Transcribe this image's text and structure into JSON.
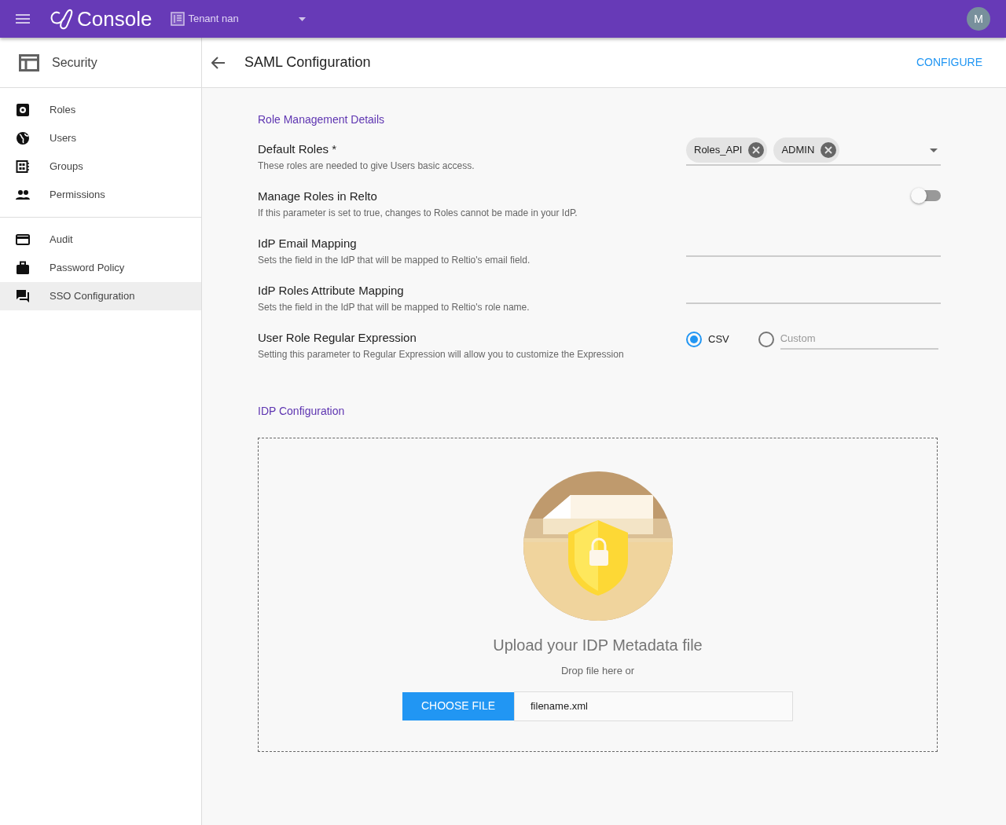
{
  "header": {
    "app_name": "Console",
    "tenant": "Tenant nan",
    "avatar": "M"
  },
  "sidebar": {
    "title": "Security",
    "groups": [
      [
        {
          "label": "Roles",
          "selected": false
        },
        {
          "label": "Users",
          "selected": false
        },
        {
          "label": "Groups",
          "selected": false
        },
        {
          "label": "Permissions",
          "selected": false
        }
      ],
      [
        {
          "label": "Audit",
          "selected": false
        },
        {
          "label": "Password Policy",
          "selected": false
        },
        {
          "label": "SSO Configuration",
          "selected": true
        }
      ]
    ]
  },
  "page": {
    "title": "SAML Configuration",
    "action": "CONFIGURE"
  },
  "role_section": {
    "heading": "Role Management Details",
    "settings": [
      {
        "kind": "chips",
        "label": "Default Roles *",
        "hint": "These roles are needed to give Users basic access.",
        "chips": [
          "Roles_API",
          "ADMIN"
        ]
      },
      {
        "kind": "toggle",
        "label": "Manage Roles in Relto",
        "hint": "If this parameter is set to true, changes to Roles cannot be made in your IdP.",
        "on": false
      },
      {
        "kind": "text",
        "label": "IdP Email Mapping",
        "hint": "Sets the field in the IdP that will be mapped to Reltio's email field."
      },
      {
        "kind": "text",
        "label": "IdP Roles Attribute Mapping",
        "hint": "Sets the field in the IdP that will be mapped to Reltio's role name."
      },
      {
        "kind": "radio",
        "label": "User Role Regular Expression",
        "hint": "Setting this parameter to Regular Expression will allow you to customize the Expression",
        "options": [
          {
            "label": "CSV",
            "selected": true
          },
          {
            "placeholder": "Custom",
            "selected": false
          }
        ]
      }
    ]
  },
  "idp_section": {
    "heading": "IDP Configuration",
    "upload_title": "Upload your IDP Metadata file",
    "upload_hint": "Drop file here or",
    "button": "CHOOSE FILE",
    "filename": "filename.xml"
  }
}
